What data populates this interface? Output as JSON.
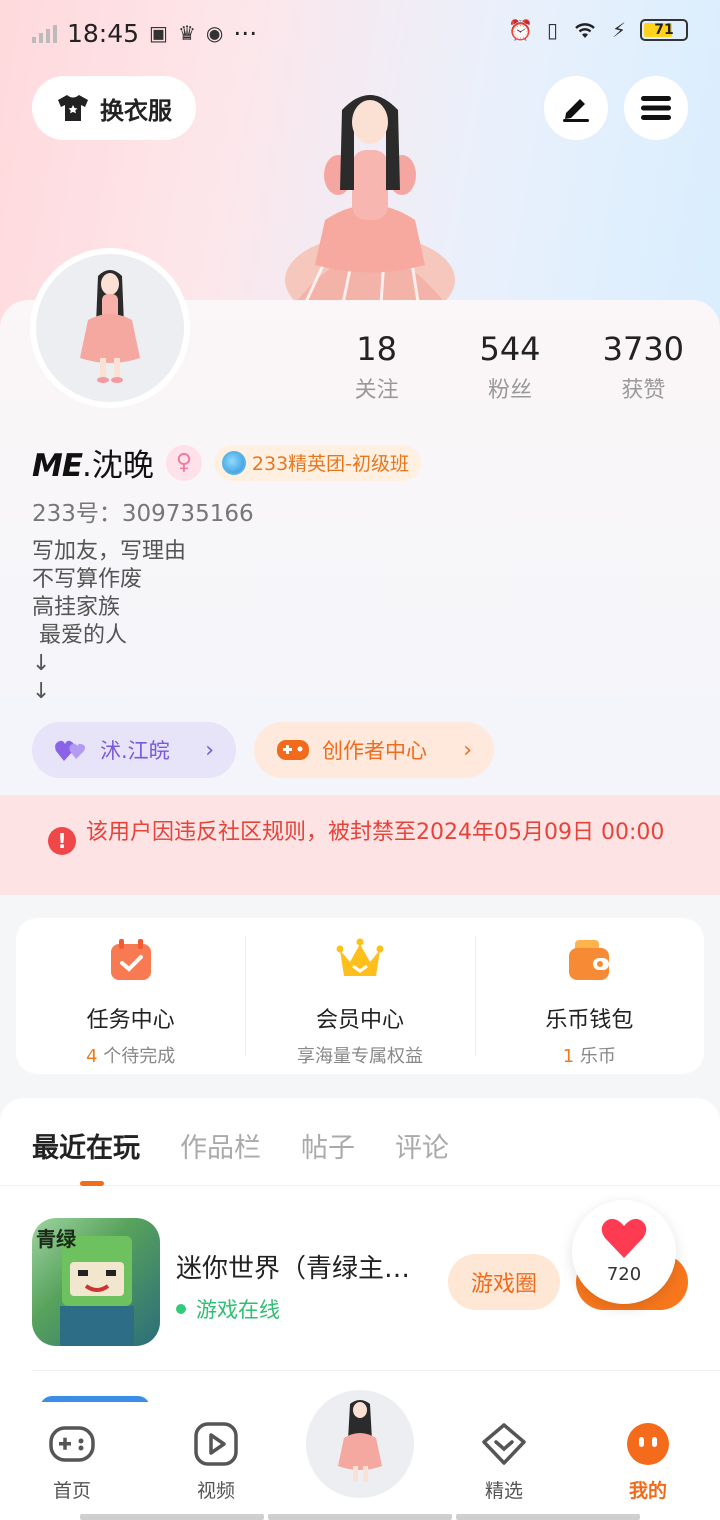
{
  "status_bar": {
    "time": "18:45",
    "dots": "···",
    "battery": "71",
    "battery_level": 0.71
  },
  "header": {
    "outfit_label": "换衣服",
    "edit_icon": "pencil-icon",
    "menu_icon": "hamburger-icon"
  },
  "stats": [
    {
      "value": "18",
      "label": "关注"
    },
    {
      "value": "544",
      "label": "粉丝"
    },
    {
      "value": "3730",
      "label": "获赞"
    }
  ],
  "profile": {
    "name_prefix": "ME",
    "name_suffix": ".沈晚",
    "gender_symbol": "♀",
    "rank": "233精英团-初级班",
    "uid": "233号：309735166",
    "bio": "写加友，写理由\n不写算作废\n高挂家族\n 最爱的人\n↓\n↓"
  },
  "chips": {
    "love_label": "沭.江皖",
    "creator_label": "创作者中心",
    "chevron": "›"
  },
  "ban_notice": {
    "icon": "!",
    "text": "该用户因违反社区规则，被封禁至2024年05月09日 00:00"
  },
  "services": [
    {
      "title": "任务中心",
      "count": "4",
      "sub": " 个待完成",
      "icon": "calendar-check-icon"
    },
    {
      "title": "会员中心",
      "count": "",
      "sub": "享海量专属权益",
      "icon": "crown-icon"
    },
    {
      "title": "乐币钱包",
      "count": "1",
      "sub": " 乐币",
      "icon": "wallet-icon"
    }
  ],
  "tabs": [
    "最近在玩",
    "作品栏",
    "帖子",
    "评论"
  ],
  "recent_game": {
    "title": "迷你世界（青绿主…",
    "icon_text": "青绿",
    "status": "游戏在线",
    "circle_label": "游戏圈",
    "likes": "720"
  },
  "bottom_nav": [
    {
      "label": "首页",
      "icon": "gamepad-icon"
    },
    {
      "label": "视频",
      "icon": "play-icon"
    },
    {
      "label": "精选",
      "icon": "heart-box-icon"
    },
    {
      "label": "我的",
      "icon": "face-icon"
    }
  ],
  "colors": {
    "accent": "#f06b1c",
    "ban_red": "#e6443a",
    "online_green": "#2fbf72"
  }
}
